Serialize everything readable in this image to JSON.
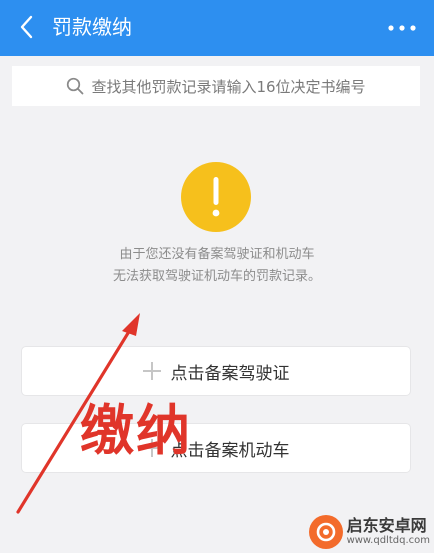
{
  "header": {
    "title": "罚款缴纳",
    "back_icon": "chevron-left-icon",
    "more_icon": "ellipsis-icon",
    "bg_color": "#2d8ff0"
  },
  "search": {
    "placeholder": "查找其他罚款记录请输入16位决定书编号",
    "icon": "search-icon"
  },
  "notice": {
    "icon": "exclamation-icon",
    "icon_color": "#f6c01c",
    "line1": "由于您还没有备案驾驶证和机动车",
    "line2": "无法获取驾驶证机动车的罚款记录。"
  },
  "actions": [
    {
      "label": "点击备案驾驶证",
      "icon": "plus-icon"
    },
    {
      "label": "点击备案机动车",
      "icon": "plus-icon"
    }
  ],
  "annotation": {
    "text": "缴纳",
    "color": "#e0352a"
  },
  "watermark": {
    "name": "启东安卓网",
    "url": "www.qdltdq.com"
  }
}
